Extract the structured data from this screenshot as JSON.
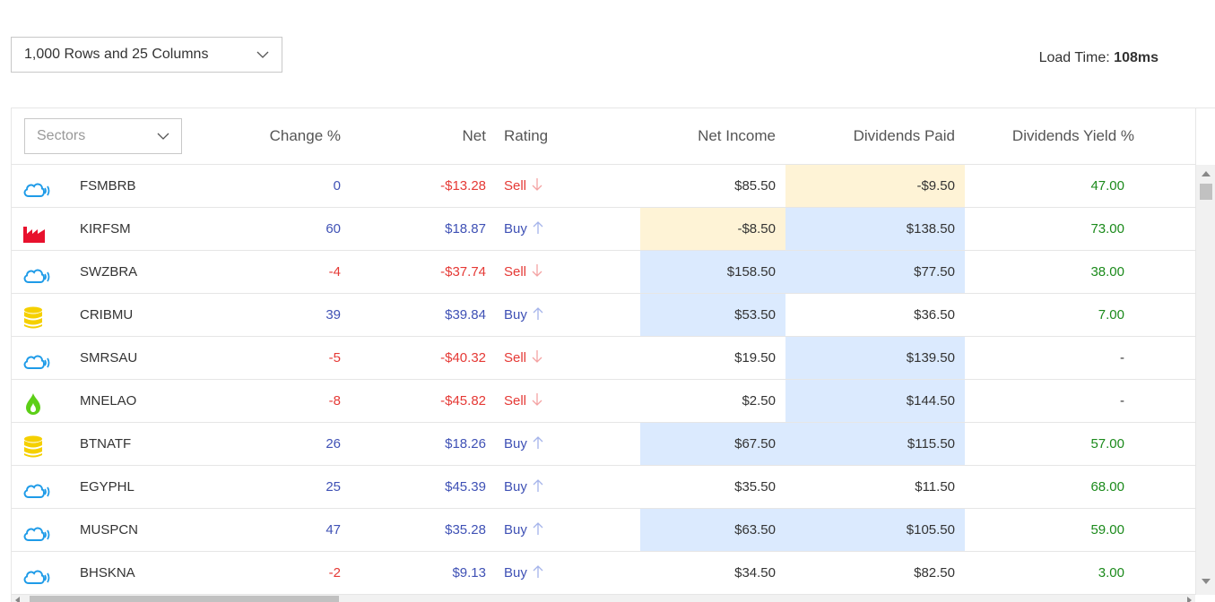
{
  "toolbar": {
    "rows_select_value": "1,000 Rows and 25 Columns",
    "load_time_label": "Load Time:",
    "load_time_value": "108ms"
  },
  "grid": {
    "sectors_placeholder": "Sectors",
    "columns": {
      "change": "Change %",
      "net": "Net",
      "rating": "Rating",
      "net_income": "Net Income",
      "dividends_paid": "Dividends Paid",
      "dividends_yield": "Dividends Yield %"
    },
    "rows": [
      {
        "icon": "cloud-wifi-icon",
        "name": "FSMBRB",
        "change": "0",
        "change_dir": "pos",
        "net": "-$13.28",
        "net_dir": "neg",
        "rating": "Sell",
        "rating_dir": "down",
        "net_income": "$85.50",
        "income_hl": "",
        "dividends_paid": "-$9.50",
        "div_hl": "yellow",
        "yield": "47.00"
      },
      {
        "icon": "factory-icon",
        "name": "KIRFSM",
        "change": "60",
        "change_dir": "pos",
        "net": "$18.87",
        "net_dir": "pos",
        "rating": "Buy",
        "rating_dir": "up",
        "net_income": "-$8.50",
        "income_hl": "yellow",
        "dividends_paid": "$138.50",
        "div_hl": "blue",
        "yield": "73.00"
      },
      {
        "icon": "cloud-wifi-icon",
        "name": "SWZBRA",
        "change": "-4",
        "change_dir": "neg",
        "net": "-$37.74",
        "net_dir": "neg",
        "rating": "Sell",
        "rating_dir": "down",
        "net_income": "$158.50",
        "income_hl": "blue",
        "dividends_paid": "$77.50",
        "div_hl": "blue",
        "yield": "38.00"
      },
      {
        "icon": "database-icon",
        "name": "CRIBMU",
        "change": "39",
        "change_dir": "pos",
        "net": "$39.84",
        "net_dir": "pos",
        "rating": "Buy",
        "rating_dir": "up",
        "net_income": "$53.50",
        "income_hl": "blue",
        "dividends_paid": "$36.50",
        "div_hl": "",
        "yield": "7.00"
      },
      {
        "icon": "cloud-wifi-icon",
        "name": "SMRSAU",
        "change": "-5",
        "change_dir": "neg",
        "net": "-$40.32",
        "net_dir": "neg",
        "rating": "Sell",
        "rating_dir": "down",
        "net_income": "$19.50",
        "income_hl": "",
        "dividends_paid": "$139.50",
        "div_hl": "blue",
        "yield": "-"
      },
      {
        "icon": "flame-icon",
        "name": "MNELAO",
        "change": "-8",
        "change_dir": "neg",
        "net": "-$45.82",
        "net_dir": "neg",
        "rating": "Sell",
        "rating_dir": "down",
        "net_income": "$2.50",
        "income_hl": "",
        "dividends_paid": "$144.50",
        "div_hl": "blue",
        "yield": "-"
      },
      {
        "icon": "database-icon",
        "name": "BTNATF",
        "change": "26",
        "change_dir": "pos",
        "net": "$18.26",
        "net_dir": "pos",
        "rating": "Buy",
        "rating_dir": "up",
        "net_income": "$67.50",
        "income_hl": "blue",
        "dividends_paid": "$115.50",
        "div_hl": "blue",
        "yield": "57.00"
      },
      {
        "icon": "cloud-wifi-icon",
        "name": "EGYPHL",
        "change": "25",
        "change_dir": "pos",
        "net": "$45.39",
        "net_dir": "pos",
        "rating": "Buy",
        "rating_dir": "up",
        "net_income": "$35.50",
        "income_hl": "",
        "dividends_paid": "$11.50",
        "div_hl": "",
        "yield": "68.00"
      },
      {
        "icon": "cloud-wifi-icon",
        "name": "MUSPCN",
        "change": "47",
        "change_dir": "pos",
        "net": "$35.28",
        "net_dir": "pos",
        "rating": "Buy",
        "rating_dir": "up",
        "net_income": "$63.50",
        "income_hl": "blue",
        "dividends_paid": "$105.50",
        "div_hl": "blue",
        "yield": "59.00"
      },
      {
        "icon": "cloud-wifi-icon",
        "name": "BHSKNA",
        "change": "-2",
        "change_dir": "neg",
        "net": "$9.13",
        "net_dir": "pos",
        "rating": "Buy",
        "rating_dir": "up",
        "net_income": "$34.50",
        "income_hl": "",
        "dividends_paid": "$82.50",
        "div_hl": "",
        "yield": "3.00"
      }
    ]
  },
  "colors": {
    "positive": "#3f51b5",
    "negative": "#e53935",
    "yield": "#1b8a1b",
    "highlight_yellow": "#fef3d6",
    "highlight_blue": "#dbeafe",
    "cloud_icon": "#1e9be8",
    "factory_icon": "#e8112d",
    "database_icon": "#f5d000",
    "flame_icon": "#5ccf17"
  }
}
